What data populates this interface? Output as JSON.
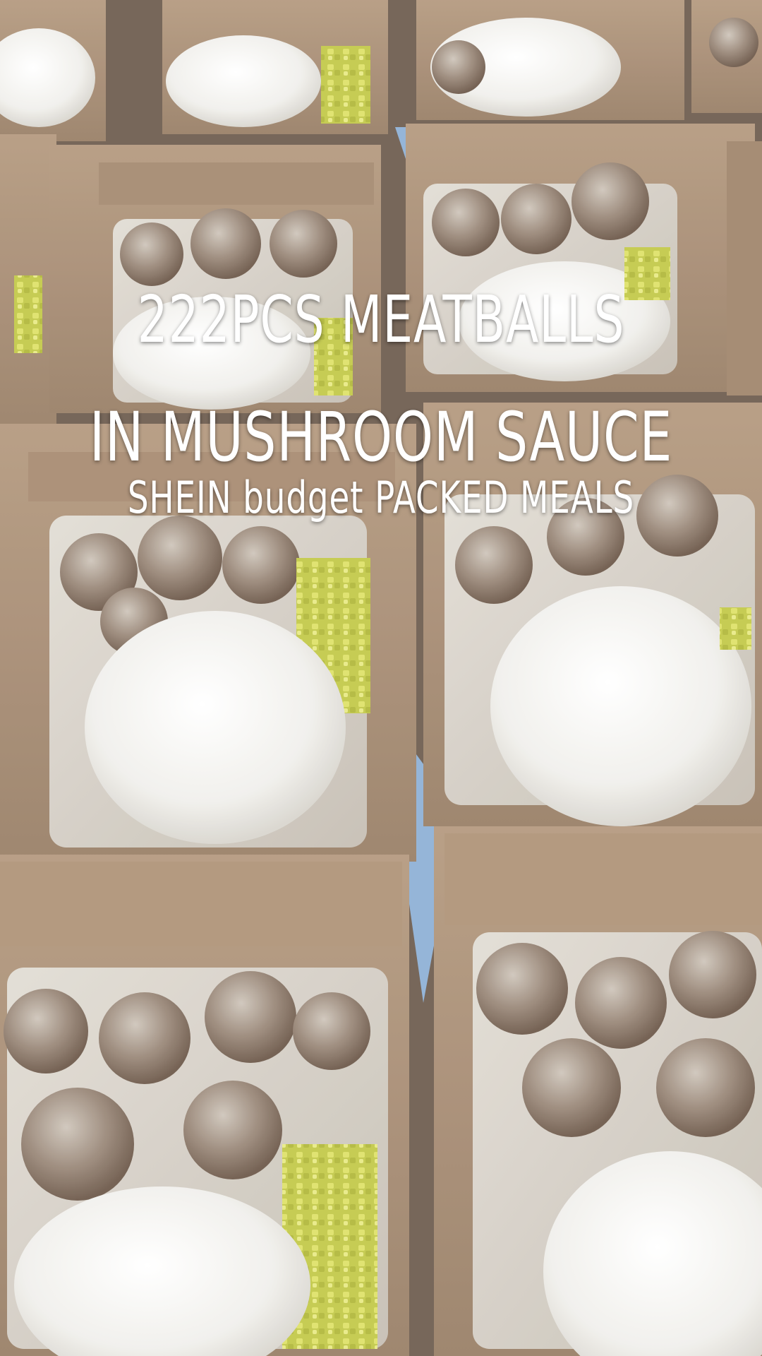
{
  "overlay_text": {
    "line1": "222PCS MEATBALLS",
    "line2": "IN MUSHROOM SAUCE",
    "line3": "SHEIN budget PACKED MEALS"
  },
  "colors": {
    "caption_text": "#ffffff",
    "box_cardboard": "#a88e74",
    "box_shadow": "#6e5a48",
    "rice": "#f4f3ef",
    "sauce": "#d8d2c8",
    "meatball": "#8a7766",
    "pickles": "#c9cf52",
    "table_blue": "#8fb1d6"
  }
}
